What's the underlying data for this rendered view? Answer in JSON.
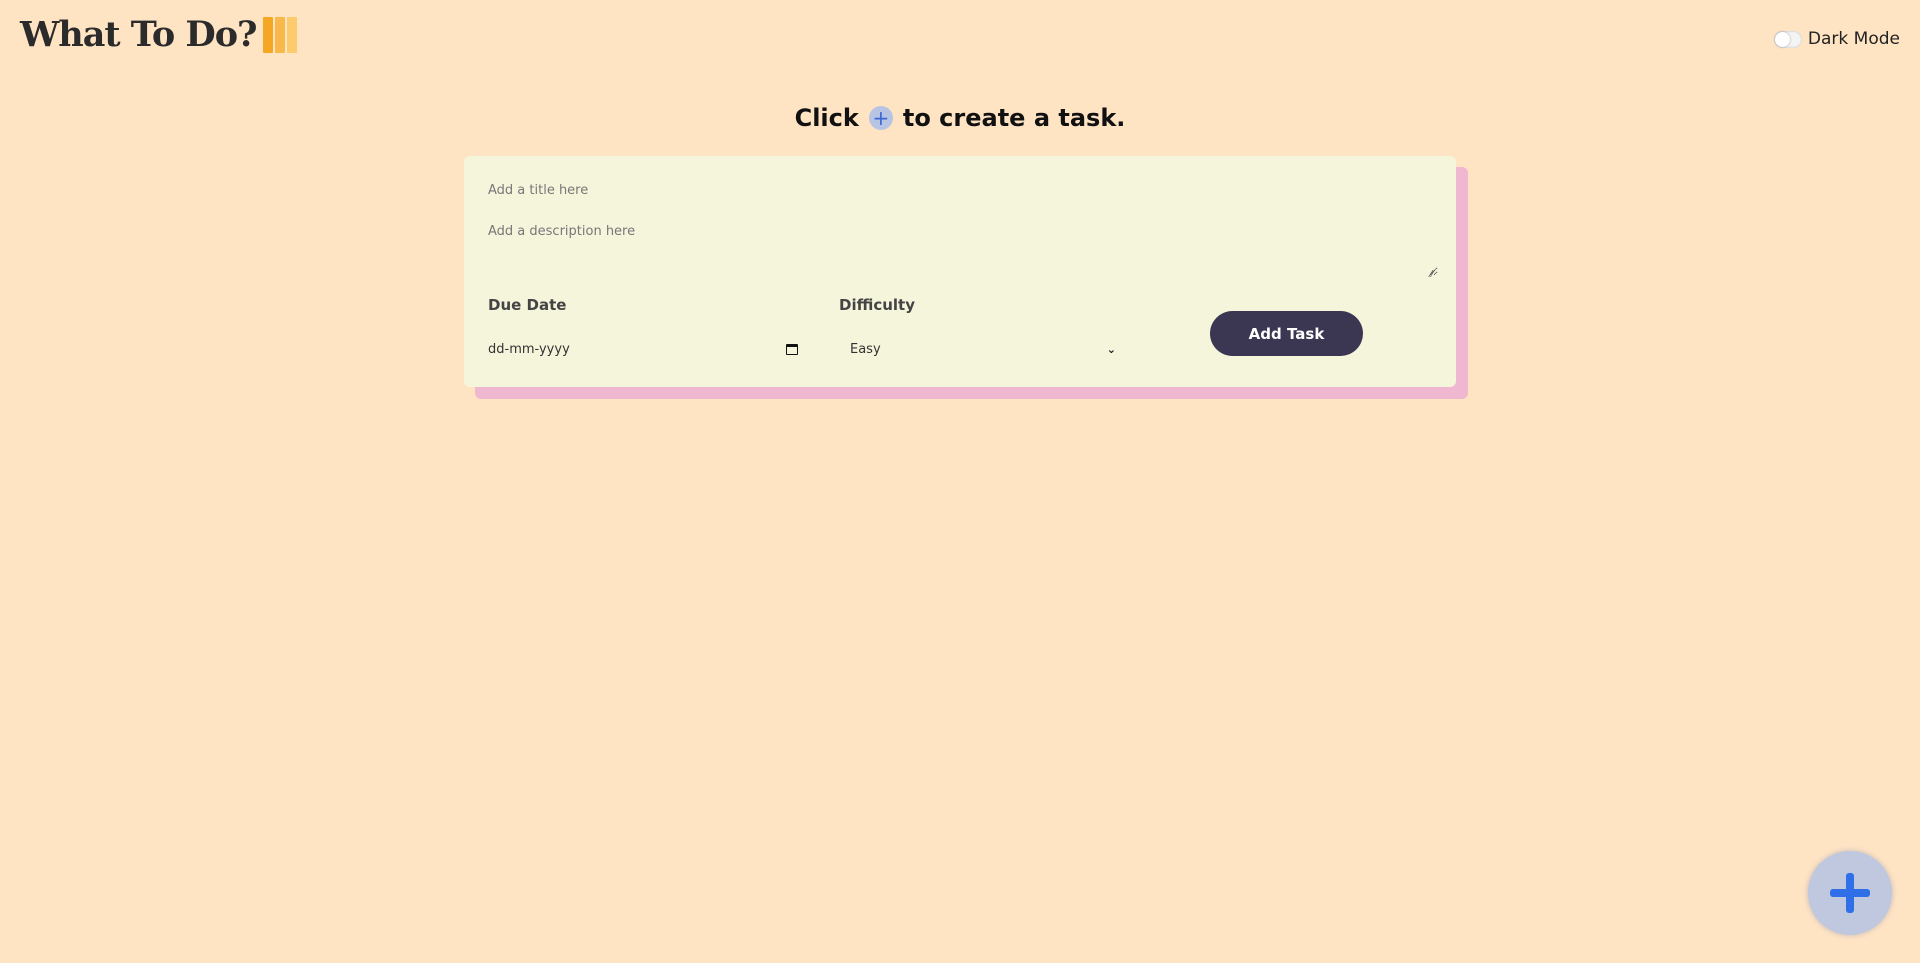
{
  "header": {
    "logo_text": "What To Do?",
    "logo_bar_colors": [
      "#f5a623",
      "#f8b84a",
      "#fbcb6e"
    ],
    "dark_mode_label": "Dark Mode",
    "dark_mode_on": false
  },
  "hint": {
    "before": "Click",
    "icon": "plus-icon",
    "after": "to create a task."
  },
  "task_form": {
    "title_placeholder": "Add a title here",
    "description_placeholder": "Add a description here",
    "due_date_label": "Due Date",
    "due_date_value": "dd-mm-yyyy",
    "difficulty_label": "Difficulty",
    "difficulty_value": "Easy",
    "submit_label": "Add Task"
  },
  "fab": {
    "icon": "plus-icon",
    "color": "#2f6fe8"
  },
  "colors": {
    "background": "#ffe4c4",
    "card": "#f5f5dc",
    "card_shadow": "#f0b7d0",
    "button": "#3b3651"
  }
}
